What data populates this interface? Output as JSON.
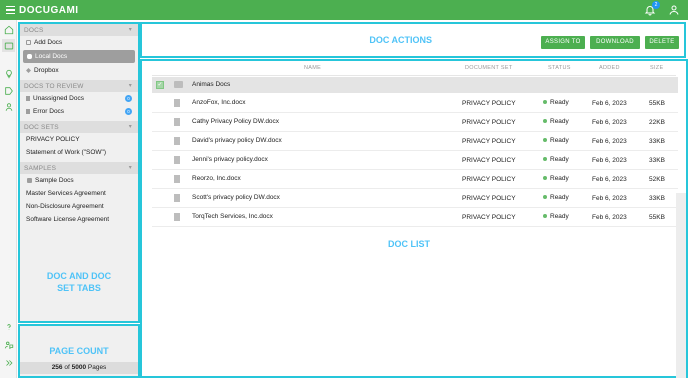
{
  "app": {
    "brand": "DOCUGAMI",
    "notification_count": "2"
  },
  "sidebar": {
    "sections": [
      {
        "title": "DOCS",
        "items": [
          {
            "label": "Add Docs"
          },
          {
            "label": "Local Docs"
          },
          {
            "label": "Dropbox"
          }
        ]
      },
      {
        "title": "DOCS TO REVIEW",
        "items": [
          {
            "label": "Unassigned Docs",
            "count": "0"
          },
          {
            "label": "Error Docs",
            "count": "0"
          }
        ]
      },
      {
        "title": "DOC SETS",
        "items": [
          {
            "label": "PRIVACY POLICY"
          },
          {
            "label": "Statement of Work (\"SOW\")"
          }
        ]
      },
      {
        "title": "SAMPLES",
        "items": [
          {
            "label": "Sample Docs"
          },
          {
            "label": "Master Services Agreement"
          },
          {
            "label": "Non-Disclosure Agreement"
          },
          {
            "label": "Software License Agreement"
          }
        ]
      }
    ],
    "overlay_label_line1": "DOC AND DOC",
    "overlay_label_line2": "SET TABS"
  },
  "page_count": {
    "label": "PAGE COUNT",
    "used": "256",
    "of_text": "of",
    "total": "5000",
    "unit": "Pages"
  },
  "actions": {
    "label": "DOC ACTIONS",
    "assign_to": "ASSIGN TO",
    "download": "DOWNLOAD",
    "delete": "DELETE"
  },
  "doc_list": {
    "label": "DOC LIST",
    "columns": {
      "name": "NAME",
      "doc_set": "DOCUMENT SET",
      "status": "STATUS",
      "added": "ADDED",
      "size": "SIZE"
    },
    "folder": "Animas Docs",
    "rows": [
      {
        "name": "AnzoFox, Inc.docx",
        "doc_set": "PRIVACY POLICY",
        "status": "Ready",
        "added": "Feb 6, 2023",
        "size": "55KB"
      },
      {
        "name": "Cathy Privacy Policy DW.docx",
        "doc_set": "PRIVACY POLICY",
        "status": "Ready",
        "added": "Feb 6, 2023",
        "size": "22KB"
      },
      {
        "name": "David's privacy policy DW.docx",
        "doc_set": "PRIVACY POLICY",
        "status": "Ready",
        "added": "Feb 6, 2023",
        "size": "33KB"
      },
      {
        "name": "Jenni's privacy policy.docx",
        "doc_set": "PRIVACY POLICY",
        "status": "Ready",
        "added": "Feb 6, 2023",
        "size": "33KB"
      },
      {
        "name": "Reorzo, Inc.docx",
        "doc_set": "PRIVACY POLICY",
        "status": "Ready",
        "added": "Feb 6, 2023",
        "size": "52KB"
      },
      {
        "name": "Scott's privacy policy DW.docx",
        "doc_set": "PRIVACY POLICY",
        "status": "Ready",
        "added": "Feb 6, 2023",
        "size": "33KB"
      },
      {
        "name": "TorqTech Services, Inc.docx",
        "doc_set": "PRIVACY POLICY",
        "status": "Ready",
        "added": "Feb 6, 2023",
        "size": "55KB"
      }
    ]
  },
  "colors": {
    "brand_green": "#4caf50",
    "annotation_cyan": "#26c6da",
    "annotation_text": "#4fc3f7",
    "badge_blue": "#42a5f5"
  }
}
